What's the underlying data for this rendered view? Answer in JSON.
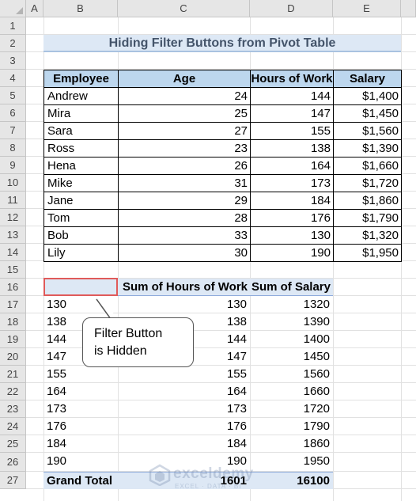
{
  "columns": [
    "A",
    "B",
    "C",
    "D",
    "E"
  ],
  "rows": [
    "1",
    "2",
    "3",
    "4",
    "5",
    "6",
    "7",
    "8",
    "9",
    "10",
    "11",
    "12",
    "13",
    "14",
    "15",
    "16",
    "17",
    "18",
    "19",
    "20",
    "21",
    "22",
    "23",
    "24",
    "25",
    "26",
    "27"
  ],
  "title": "Hiding Filter Buttons from Pivot Table",
  "table": {
    "headers": [
      "Employee",
      "Age",
      "Hours of Work",
      "Salary"
    ],
    "rows": [
      [
        "Andrew",
        "24",
        "144",
        "$1,400"
      ],
      [
        "Mira",
        "25",
        "147",
        "$1,450"
      ],
      [
        "Sara",
        "27",
        "155",
        "$1,560"
      ],
      [
        "Ross",
        "23",
        "138",
        "$1,390"
      ],
      [
        "Hena",
        "26",
        "164",
        "$1,660"
      ],
      [
        "Mike",
        "31",
        "173",
        "$1,720"
      ],
      [
        "Jane",
        "29",
        "184",
        "$1,860"
      ],
      [
        "Tom",
        "28",
        "176",
        "$1,790"
      ],
      [
        "Bob",
        "33",
        "130",
        "$1,320"
      ],
      [
        "Lily",
        "30",
        "190",
        "$1,950"
      ]
    ]
  },
  "pivot": {
    "headers": [
      "",
      "Sum of Hours of Work",
      "Sum of Salary"
    ],
    "rows": [
      [
        "130",
        "130",
        "1320"
      ],
      [
        "138",
        "138",
        "1390"
      ],
      [
        "144",
        "144",
        "1400"
      ],
      [
        "147",
        "147",
        "1450"
      ],
      [
        "155",
        "155",
        "1560"
      ],
      [
        "164",
        "164",
        "1660"
      ],
      [
        "173",
        "173",
        "1720"
      ],
      [
        "176",
        "176",
        "1790"
      ],
      [
        "184",
        "184",
        "1860"
      ],
      [
        "190",
        "190",
        "1950"
      ]
    ],
    "total": [
      "Grand Total",
      "1601",
      "16100"
    ]
  },
  "callout": {
    "line1": "Filter Button",
    "line2": "is Hidden"
  },
  "watermark": {
    "name": "exceldemy",
    "tagline": "EXCEL · DATA · BI"
  },
  "colors": {
    "header_fill": "#bdd7ee",
    "pivot_fill": "#dde8f5",
    "selection": "#e05a5a"
  }
}
